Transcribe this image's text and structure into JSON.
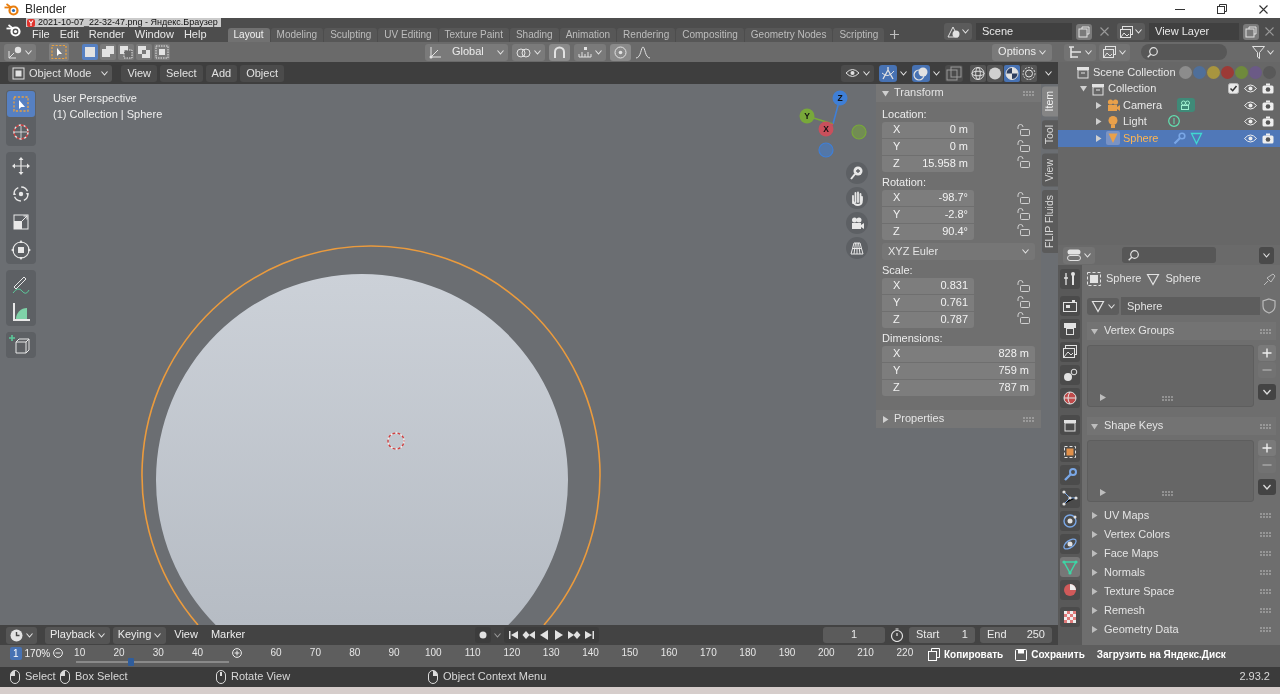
{
  "window": {
    "title": "Blender"
  },
  "browser_overlay": {
    "title": "2021-10-07_22-32-47.png - Яндекс.Браузер",
    "zoom": "170%",
    "zoom_slider": {
      "level": 0.36
    },
    "actions": [
      "Копировать",
      "Сохранить",
      "Загрузить на Яндекс.Диск"
    ]
  },
  "menu": [
    "File",
    "Edit",
    "Render",
    "Window",
    "Help"
  ],
  "workspaces": [
    {
      "label": "Layout",
      "selected": true
    },
    {
      "label": "Modeling",
      "selected": false
    },
    {
      "label": "Sculpting",
      "selected": false
    },
    {
      "label": "UV Editing",
      "selected": false
    },
    {
      "label": "Texture Paint",
      "selected": false
    },
    {
      "label": "Shading",
      "selected": false
    },
    {
      "label": "Animation",
      "selected": false
    },
    {
      "label": "Rendering",
      "selected": false
    },
    {
      "label": "Compositing",
      "selected": false
    },
    {
      "label": "Geometry Nodes",
      "selected": false
    },
    {
      "label": "Scripting",
      "selected": false
    }
  ],
  "scene": "Scene",
  "view_layer": "View Layer",
  "tool_header": {
    "select_modes": [
      {
        "kind": "set",
        "selected": true
      },
      {
        "kind": "extend",
        "selected": false
      },
      {
        "kind": "subtract",
        "selected": false
      },
      {
        "kind": "difference",
        "selected": false
      },
      {
        "kind": "intersect",
        "selected": false
      }
    ],
    "orientation": "Global",
    "options": "Options"
  },
  "viewport_header": {
    "mode": "Object Mode",
    "menus": [
      "View",
      "Select",
      "Add",
      "Object"
    ],
    "toggles": [
      {
        "kind": "gizmos",
        "on": true
      },
      {
        "kind": "overlays",
        "on": true
      },
      {
        "kind": "xray",
        "on": false
      }
    ],
    "shading": [
      {
        "kind": "wireframe",
        "selected": false
      },
      {
        "kind": "solid",
        "selected": false
      },
      {
        "kind": "material",
        "selected": true
      },
      {
        "kind": "rendered",
        "selected": false
      }
    ]
  },
  "viewport": {
    "toolbar": [
      {
        "tools": [
          {
            "kind": "select_box",
            "selected": true
          },
          {
            "kind": "cursor",
            "selected": false
          }
        ]
      },
      {
        "tools": [
          {
            "kind": "move",
            "selected": false
          },
          {
            "kind": "rotate",
            "selected": false
          },
          {
            "kind": "scale",
            "selected": false
          },
          {
            "kind": "transform",
            "selected": false
          }
        ]
      },
      {
        "tools": [
          {
            "kind": "annotate",
            "selected": false
          },
          {
            "kind": "measure",
            "selected": false
          }
        ]
      },
      {
        "tools": [
          {
            "kind": "add_cube",
            "selected": false
          }
        ]
      }
    ],
    "info": [
      "User Perspective",
      "(1) Collection | Sphere"
    ],
    "axes": [
      {
        "label": "Z",
        "color": "#3f7fd6"
      },
      {
        "label": "Y",
        "color": "#78a83a"
      },
      {
        "label": "X",
        "color": "#c8505c"
      }
    ]
  },
  "sidebar": {
    "tabs": [
      {
        "label": "Item",
        "selected": true
      },
      {
        "label": "Tool",
        "selected": false
      },
      {
        "label": "View",
        "selected": false
      },
      {
        "label": "FLIP Fluids",
        "selected": false
      }
    ],
    "panels": [
      {
        "title": "Transform",
        "expanded": true,
        "groups": [
          {
            "kind": "vector",
            "label": "Location:",
            "locks": true,
            "fields": [
              {
                "axis": "X",
                "value": "0 m"
              },
              {
                "axis": "Y",
                "value": "0 m"
              },
              {
                "axis": "Z",
                "value": "15.958 m"
              }
            ]
          },
          {
            "kind": "vector",
            "label": "Rotation:",
            "locks": true,
            "fields": [
              {
                "axis": "X",
                "value": "-98.7°"
              },
              {
                "axis": "Y",
                "value": "-2.8°"
              },
              {
                "axis": "Z",
                "value": "90.4°"
              }
            ]
          },
          {
            "kind": "dropdown",
            "value": "XYZ Euler"
          },
          {
            "kind": "vector",
            "label": "Scale:",
            "locks": true,
            "fields": [
              {
                "axis": "X",
                "value": "0.831"
              },
              {
                "axis": "Y",
                "value": "0.761"
              },
              {
                "axis": "Z",
                "value": "0.787"
              }
            ]
          },
          {
            "kind": "vector",
            "label": "Dimensions:",
            "locks": false,
            "fields": [
              {
                "axis": "X",
                "value": "828 m"
              },
              {
                "axis": "Y",
                "value": "759 m"
              },
              {
                "axis": "Z",
                "value": "787 m"
              }
            ]
          }
        ]
      },
      {
        "title": "Properties",
        "expanded": false
      }
    ]
  },
  "outliner": {
    "palette": [
      {
        "color": "#8c8c8c"
      },
      {
        "color": "#4f6f9a"
      },
      {
        "color": "#a8953f"
      },
      {
        "color": "#9c3a36"
      },
      {
        "color": "#6f8a3c"
      },
      {
        "color": "#6b5a86"
      },
      {
        "color": "#595959"
      }
    ],
    "tree": [
      {
        "label": "Scene Collection",
        "kind": "scene_collection",
        "selected": false,
        "children": [
          {
            "label": "Collection",
            "kind": "collection",
            "selected": false,
            "expanded": true,
            "checked": true,
            "children": [
              {
                "label": "Camera",
                "kind": "camera",
                "selected": false,
                "expanded": false
              },
              {
                "label": "Light",
                "kind": "light",
                "selected": false,
                "expanded": false
              },
              {
                "label": "Sphere",
                "kind": "mesh",
                "selected": true,
                "expanded": false
              }
            ]
          }
        ]
      }
    ]
  },
  "properties": {
    "tab_groups": [
      {
        "tabs": [
          {
            "kind": "tool",
            "selected": false
          }
        ]
      },
      {
        "tabs": [
          {
            "kind": "render",
            "selected": false
          },
          {
            "kind": "output",
            "selected": false
          },
          {
            "kind": "view_layer",
            "selected": false
          },
          {
            "kind": "scene",
            "selected": false
          },
          {
            "kind": "world",
            "selected": false
          }
        ]
      },
      {
        "tabs": [
          {
            "kind": "collection",
            "selected": false
          }
        ]
      },
      {
        "tabs": [
          {
            "kind": "object",
            "selected": false
          },
          {
            "kind": "modifiers",
            "selected": false
          },
          {
            "kind": "particles",
            "selected": false
          },
          {
            "kind": "physics",
            "selected": false
          },
          {
            "kind": "constraints",
            "selected": false
          },
          {
            "kind": "data",
            "selected": true
          },
          {
            "kind": "material",
            "selected": false
          }
        ]
      },
      {
        "tabs": [
          {
            "kind": "texture",
            "selected": false
          }
        ]
      }
    ],
    "breadcrumb": [
      "Sphere",
      "Sphere"
    ],
    "datablock": "Sphere",
    "panels": [
      {
        "title": "Vertex Groups",
        "expanded": true
      },
      {
        "title": "Shape Keys",
        "expanded": true
      },
      {
        "title": "UV Maps",
        "expanded": false
      },
      {
        "title": "Vertex Colors",
        "expanded": false
      },
      {
        "title": "Face Maps",
        "expanded": false
      },
      {
        "title": "Normals",
        "expanded": false
      },
      {
        "title": "Texture Space",
        "expanded": false
      },
      {
        "title": "Remesh",
        "expanded": false
      },
      {
        "title": "Geometry Data",
        "expanded": false
      }
    ]
  },
  "timeline": {
    "menus": [
      {
        "label": "Playback",
        "dropdown": true
      },
      {
        "label": "Keying",
        "dropdown": true
      },
      {
        "label": "View",
        "dropdown": false
      },
      {
        "label": "Marker",
        "dropdown": false
      }
    ],
    "current_frame": "1",
    "start": {
      "label": "Start",
      "value": "1"
    },
    "end": {
      "label": "End",
      "value": "250"
    },
    "playhead": "1",
    "ruler": [
      {
        "kind": "tick",
        "label": "10"
      },
      {
        "kind": "tick",
        "label": "20"
      },
      {
        "kind": "tick",
        "label": "30"
      },
      {
        "kind": "tick",
        "label": "40"
      },
      {
        "kind": "zoom_in"
      },
      {
        "kind": "tick",
        "label": "60"
      },
      {
        "kind": "tick",
        "label": "70"
      },
      {
        "kind": "tick",
        "label": "80"
      },
      {
        "kind": "tick",
        "label": "90"
      },
      {
        "kind": "tick",
        "label": "100"
      },
      {
        "kind": "tick",
        "label": "110"
      },
      {
        "kind": "tick",
        "label": "120"
      },
      {
        "kind": "tick",
        "label": "130"
      },
      {
        "kind": "tick",
        "label": "140"
      },
      {
        "kind": "tick",
        "label": "150"
      },
      {
        "kind": "tick",
        "label": "160"
      },
      {
        "kind": "tick",
        "label": "170"
      },
      {
        "kind": "tick",
        "label": "180"
      },
      {
        "kind": "tick",
        "label": "190"
      },
      {
        "kind": "tick",
        "label": "200"
      },
      {
        "kind": "tick",
        "label": "210"
      },
      {
        "kind": "tick",
        "label": "220"
      }
    ]
  },
  "status_bar": {
    "hints": [
      {
        "kind": "left_click",
        "label": "Select"
      },
      {
        "kind": "left_drag",
        "label": "Box Select"
      },
      {
        "kind": "middle_drag",
        "label": "Rotate View"
      },
      {
        "kind": "right_click",
        "label": "Object Context Menu"
      }
    ],
    "version": "2.93.2"
  }
}
